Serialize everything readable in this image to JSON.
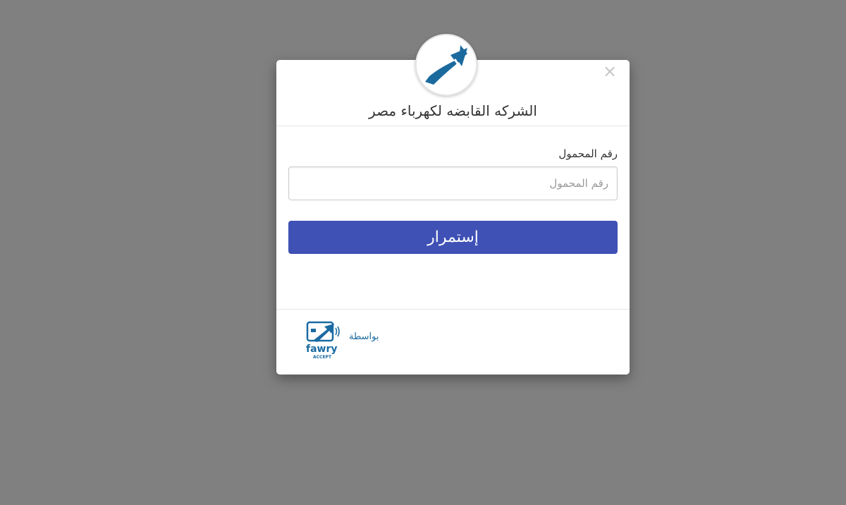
{
  "merchant": {
    "name": "الشركه القابضه لكهرباء مصر",
    "logo_icon": "arrow-up-right-icon"
  },
  "form": {
    "phone_label": "رقم المحمول",
    "phone_placeholder": "رقم المحمول",
    "phone_value": "",
    "submit_label": "إستمرار"
  },
  "footer": {
    "powered_by_text": "بواسطة",
    "brand_logo_text": "fawry",
    "brand_logo_subtext": "ACCEPT"
  },
  "colors": {
    "overlay": "#808080",
    "primary_button": "#3f51b5",
    "brand_blue": "#1a6aa2"
  }
}
